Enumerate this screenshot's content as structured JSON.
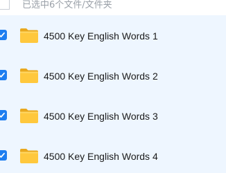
{
  "header": {
    "selection_text": "已选中6个文件/文件夹"
  },
  "files": [
    {
      "name": "4500 Key English Words 1",
      "checked": true,
      "icon": "folder-icon"
    },
    {
      "name": "4500 Key English Words 2",
      "checked": true,
      "icon": "folder-icon"
    },
    {
      "name": "4500 Key English Words 3",
      "checked": true,
      "icon": "folder-icon"
    },
    {
      "name": "4500 Key English Words 4",
      "checked": true,
      "icon": "folder-icon"
    }
  ],
  "colors": {
    "accent": "#1e7ef0",
    "row_background": "#eef6ff",
    "folder_body": "#ffc83d",
    "folder_tab": "#e9a81e"
  }
}
